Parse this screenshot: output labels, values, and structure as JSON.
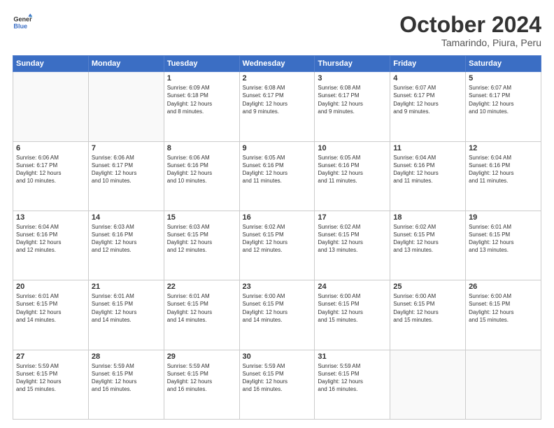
{
  "logo": {
    "line1": "General",
    "line2": "Blue"
  },
  "header": {
    "month": "October 2024",
    "location": "Tamarindo, Piura, Peru"
  },
  "weekdays": [
    "Sunday",
    "Monday",
    "Tuesday",
    "Wednesday",
    "Thursday",
    "Friday",
    "Saturday"
  ],
  "weeks": [
    [
      {
        "day": "",
        "info": ""
      },
      {
        "day": "",
        "info": ""
      },
      {
        "day": "1",
        "info": "Sunrise: 6:09 AM\nSunset: 6:18 PM\nDaylight: 12 hours\nand 8 minutes."
      },
      {
        "day": "2",
        "info": "Sunrise: 6:08 AM\nSunset: 6:17 PM\nDaylight: 12 hours\nand 9 minutes."
      },
      {
        "day": "3",
        "info": "Sunrise: 6:08 AM\nSunset: 6:17 PM\nDaylight: 12 hours\nand 9 minutes."
      },
      {
        "day": "4",
        "info": "Sunrise: 6:07 AM\nSunset: 6:17 PM\nDaylight: 12 hours\nand 9 minutes."
      },
      {
        "day": "5",
        "info": "Sunrise: 6:07 AM\nSunset: 6:17 PM\nDaylight: 12 hours\nand 10 minutes."
      }
    ],
    [
      {
        "day": "6",
        "info": "Sunrise: 6:06 AM\nSunset: 6:17 PM\nDaylight: 12 hours\nand 10 minutes."
      },
      {
        "day": "7",
        "info": "Sunrise: 6:06 AM\nSunset: 6:17 PM\nDaylight: 12 hours\nand 10 minutes."
      },
      {
        "day": "8",
        "info": "Sunrise: 6:06 AM\nSunset: 6:16 PM\nDaylight: 12 hours\nand 10 minutes."
      },
      {
        "day": "9",
        "info": "Sunrise: 6:05 AM\nSunset: 6:16 PM\nDaylight: 12 hours\nand 11 minutes."
      },
      {
        "day": "10",
        "info": "Sunrise: 6:05 AM\nSunset: 6:16 PM\nDaylight: 12 hours\nand 11 minutes."
      },
      {
        "day": "11",
        "info": "Sunrise: 6:04 AM\nSunset: 6:16 PM\nDaylight: 12 hours\nand 11 minutes."
      },
      {
        "day": "12",
        "info": "Sunrise: 6:04 AM\nSunset: 6:16 PM\nDaylight: 12 hours\nand 11 minutes."
      }
    ],
    [
      {
        "day": "13",
        "info": "Sunrise: 6:04 AM\nSunset: 6:16 PM\nDaylight: 12 hours\nand 12 minutes."
      },
      {
        "day": "14",
        "info": "Sunrise: 6:03 AM\nSunset: 6:16 PM\nDaylight: 12 hours\nand 12 minutes."
      },
      {
        "day": "15",
        "info": "Sunrise: 6:03 AM\nSunset: 6:15 PM\nDaylight: 12 hours\nand 12 minutes."
      },
      {
        "day": "16",
        "info": "Sunrise: 6:02 AM\nSunset: 6:15 PM\nDaylight: 12 hours\nand 12 minutes."
      },
      {
        "day": "17",
        "info": "Sunrise: 6:02 AM\nSunset: 6:15 PM\nDaylight: 12 hours\nand 13 minutes."
      },
      {
        "day": "18",
        "info": "Sunrise: 6:02 AM\nSunset: 6:15 PM\nDaylight: 12 hours\nand 13 minutes."
      },
      {
        "day": "19",
        "info": "Sunrise: 6:01 AM\nSunset: 6:15 PM\nDaylight: 12 hours\nand 13 minutes."
      }
    ],
    [
      {
        "day": "20",
        "info": "Sunrise: 6:01 AM\nSunset: 6:15 PM\nDaylight: 12 hours\nand 14 minutes."
      },
      {
        "day": "21",
        "info": "Sunrise: 6:01 AM\nSunset: 6:15 PM\nDaylight: 12 hours\nand 14 minutes."
      },
      {
        "day": "22",
        "info": "Sunrise: 6:01 AM\nSunset: 6:15 PM\nDaylight: 12 hours\nand 14 minutes."
      },
      {
        "day": "23",
        "info": "Sunrise: 6:00 AM\nSunset: 6:15 PM\nDaylight: 12 hours\nand 14 minutes."
      },
      {
        "day": "24",
        "info": "Sunrise: 6:00 AM\nSunset: 6:15 PM\nDaylight: 12 hours\nand 15 minutes."
      },
      {
        "day": "25",
        "info": "Sunrise: 6:00 AM\nSunset: 6:15 PM\nDaylight: 12 hours\nand 15 minutes."
      },
      {
        "day": "26",
        "info": "Sunrise: 6:00 AM\nSunset: 6:15 PM\nDaylight: 12 hours\nand 15 minutes."
      }
    ],
    [
      {
        "day": "27",
        "info": "Sunrise: 5:59 AM\nSunset: 6:15 PM\nDaylight: 12 hours\nand 15 minutes."
      },
      {
        "day": "28",
        "info": "Sunrise: 5:59 AM\nSunset: 6:15 PM\nDaylight: 12 hours\nand 16 minutes."
      },
      {
        "day": "29",
        "info": "Sunrise: 5:59 AM\nSunset: 6:15 PM\nDaylight: 12 hours\nand 16 minutes."
      },
      {
        "day": "30",
        "info": "Sunrise: 5:59 AM\nSunset: 6:15 PM\nDaylight: 12 hours\nand 16 minutes."
      },
      {
        "day": "31",
        "info": "Sunrise: 5:59 AM\nSunset: 6:15 PM\nDaylight: 12 hours\nand 16 minutes."
      },
      {
        "day": "",
        "info": ""
      },
      {
        "day": "",
        "info": ""
      }
    ]
  ]
}
